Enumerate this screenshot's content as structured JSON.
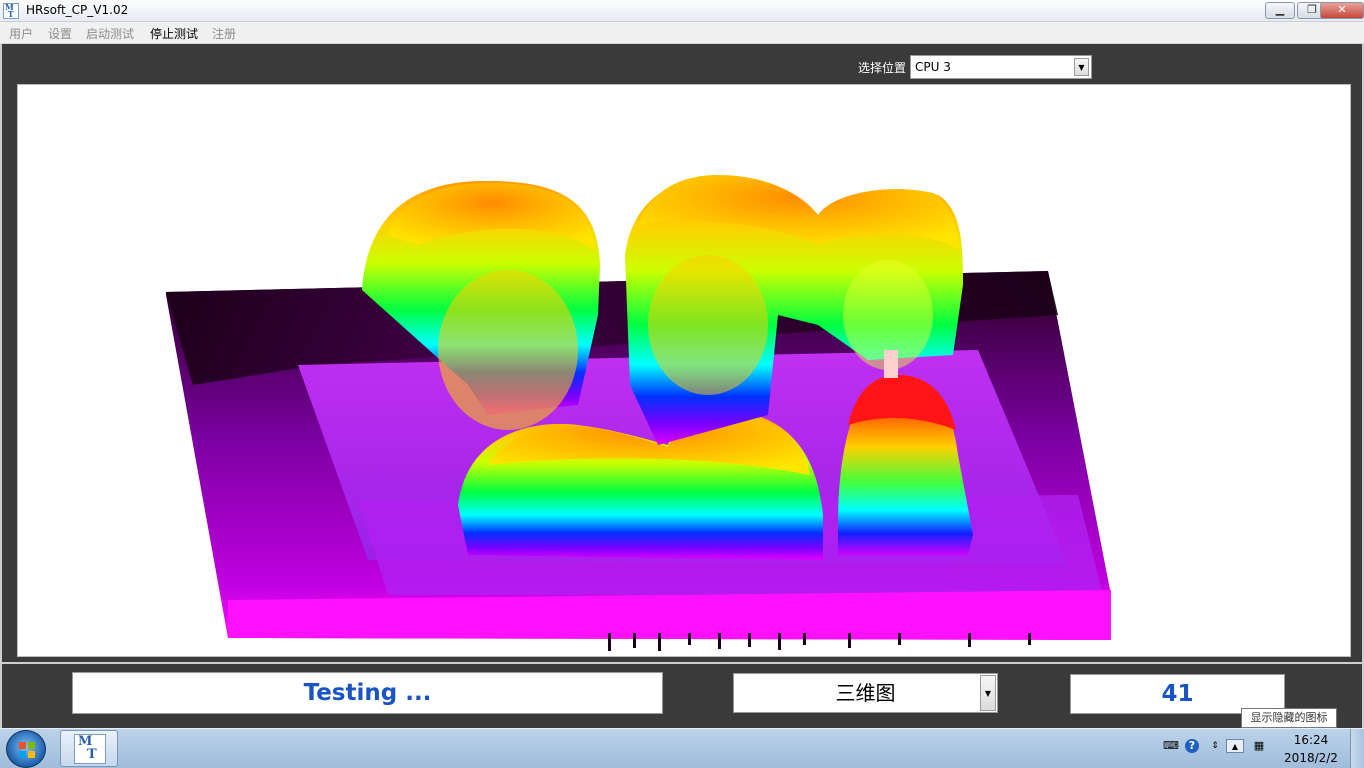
{
  "window": {
    "title": "HRsoft_CP_V1.02",
    "minimize_icon": "minimize-icon",
    "maximize_icon": "restore-icon",
    "close_icon": "close-icon"
  },
  "menu": {
    "items": [
      {
        "label": "用户",
        "enabled": false
      },
      {
        "label": "设置",
        "enabled": false
      },
      {
        "label": "启动测试",
        "enabled": false
      },
      {
        "label": "停止测试",
        "enabled": true
      },
      {
        "label": "注册",
        "enabled": false
      }
    ]
  },
  "position": {
    "label": "选择位置",
    "selected": "CPU 3"
  },
  "plot": {
    "type": "3d-surface",
    "colormap": [
      "#000000",
      "#ff00ff",
      "#8a2be2",
      "#0000ff",
      "#00ffff",
      "#00ff00",
      "#ffff00",
      "#ffa500",
      "#ff0000",
      "#ffffff"
    ]
  },
  "status": {
    "text": "Testing ...",
    "color": "#1a54c4"
  },
  "view": {
    "selected": "三维图"
  },
  "count": {
    "value": "41"
  },
  "tooltip": {
    "text": "显示隐藏的图标"
  },
  "taskbar": {
    "start_icon": "windows-start-icon",
    "app_icon": "mt-app-icon",
    "clock_time": "16:24",
    "clock_date": "2018/2/2"
  }
}
